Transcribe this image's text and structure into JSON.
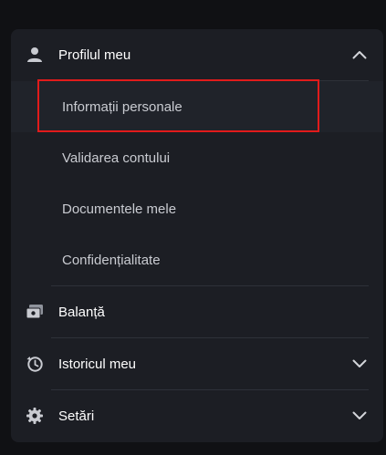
{
  "menu": {
    "profile": {
      "label": "Profilul meu",
      "icon": "user-icon",
      "chevron": "chevron-up-icon",
      "items": [
        {
          "label": "Informații personale"
        },
        {
          "label": "Validarea contului"
        },
        {
          "label": "Documentele mele"
        },
        {
          "label": "Confidențialitate"
        }
      ]
    },
    "balance": {
      "label": "Balanță",
      "icon": "wallet-icon"
    },
    "history": {
      "label": "Istoricul meu",
      "icon": "history-icon",
      "chevron": "chevron-down-icon"
    },
    "settings": {
      "label": "Setări",
      "icon": "gear-icon",
      "chevron": "chevron-down-icon"
    }
  },
  "colors": {
    "highlight": "#e11b1b",
    "panel": "#1c1e24",
    "background": "#101114"
  }
}
